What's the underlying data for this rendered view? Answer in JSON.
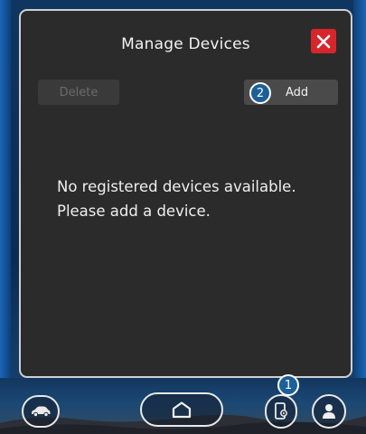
{
  "dialog": {
    "title": "Manage Devices",
    "delete_label": "Delete",
    "add_label": "Add",
    "empty_line1": "No registered devices available.",
    "empty_line2": "Please add a device."
  },
  "callouts": {
    "add": "2",
    "devices": "1"
  },
  "icons": {
    "close": "close-icon",
    "car": "car-icon",
    "home": "home-icon",
    "devices": "phone-settings-icon",
    "profile": "person-icon"
  },
  "colors": {
    "dialog_bg": "#2b2b2b",
    "close_red": "#d6262b",
    "callout_blue": "#1d5f98",
    "frame_blue": "#1a66b8"
  }
}
